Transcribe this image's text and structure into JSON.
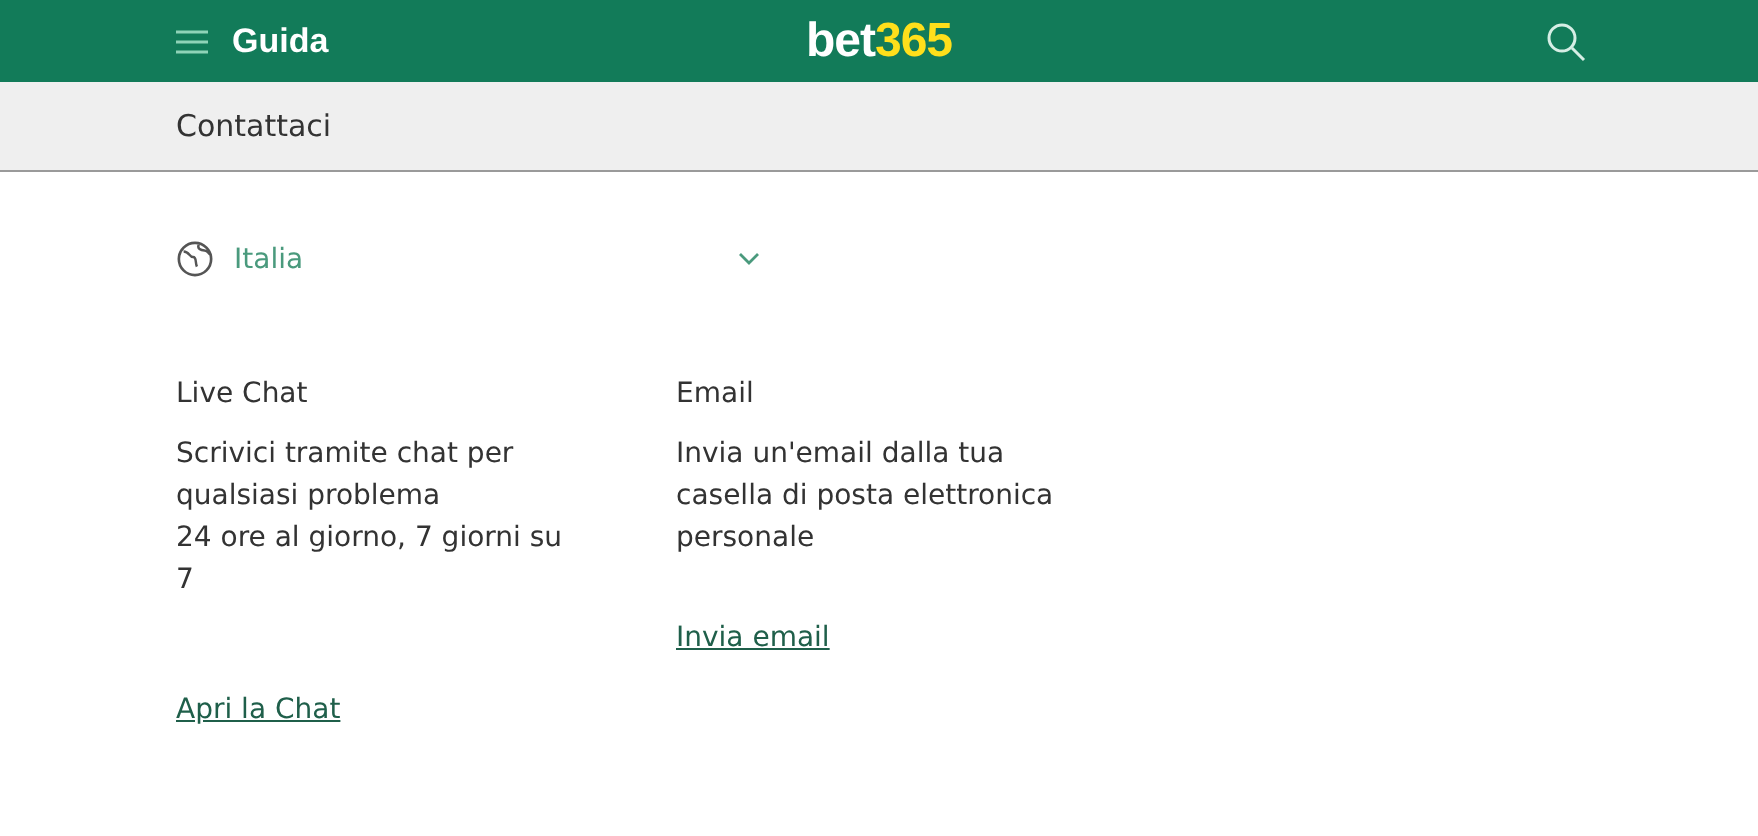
{
  "header": {
    "title": "Guida",
    "logo": {
      "part_1": "bet",
      "part_2": "365"
    }
  },
  "subheader": {
    "title": "Contattaci"
  },
  "country": {
    "value": "Italia"
  },
  "contacts": [
    {
      "title": "Live Chat",
      "lines": [
        "Scrivici tramite chat per",
        "qualsiasi problema",
        "24 ore al giorno, 7 giorni su",
        "7"
      ],
      "link": "Apri la Chat"
    },
    {
      "title": "Email",
      "lines": [
        "Invia un'email dalla tua",
        "casella di posta elettronica",
        "personale"
      ],
      "link": "Invia email"
    }
  ]
}
